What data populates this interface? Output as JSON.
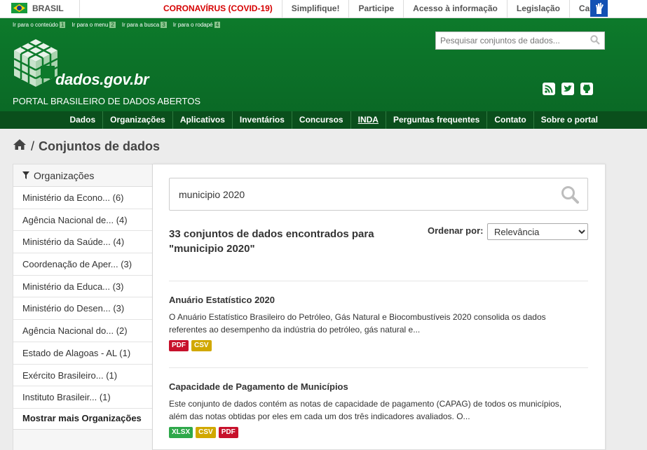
{
  "gov_bar": {
    "country": "BRASIL",
    "links": [
      "CORONAVÍRUS (COVID-19)",
      "Simplifique!",
      "Participe",
      "Acesso à informação",
      "Legislação",
      "Canais"
    ]
  },
  "skip_links": [
    {
      "label": "Ir para o conteúdo",
      "key": "1"
    },
    {
      "label": "Ir para o menu",
      "key": "2"
    },
    {
      "label": "Ir para a busca",
      "key": "3"
    },
    {
      "label": "Ir para o rodapé",
      "key": "4"
    }
  ],
  "header": {
    "logo_text": "dados.gov.br",
    "portal_name": "PORTAL BRASILEIRO DE DADOS ABERTOS",
    "search_placeholder": "Pesquisar conjuntos de dados...",
    "social_icons": [
      "rss-icon",
      "twitter-icon",
      "github-icon"
    ]
  },
  "nav": [
    "Dados",
    "Organizações",
    "Aplicativos",
    "Inventários",
    "Concursos",
    "INDA",
    "Perguntas frequentes",
    "Contato",
    "Sobre o portal"
  ],
  "breadcrumb": {
    "separator": "/",
    "title": "Conjuntos de dados"
  },
  "sidebar": {
    "heading": "Organizações",
    "items": [
      "Ministério da Econo... (6)",
      "Agência Nacional de... (4)",
      "Ministério da Saúde... (4)",
      "Coordenação de Aper... (3)",
      "Ministério da Educa... (3)",
      "Ministério do Desen... (3)",
      "Agência Nacional do... (2)",
      "Estado de Alagoas - AL (1)",
      "Exército Brasileiro... (1)",
      "Instituto Brasileir... (1)"
    ],
    "more": "Mostrar mais Organizações"
  },
  "search": {
    "query": "municipio 2020"
  },
  "results": {
    "count_text": "33 conjuntos de dados encontrados para \"municipio 2020\"",
    "order_label": "Ordenar por:",
    "order_value": "Relevância"
  },
  "datasets": [
    {
      "title": "Anuário Estatístico 2020",
      "description": "O Anuário Estatístico Brasileiro do Petróleo, Gás Natural e Biocombustíveis 2020 consolida os dados referentes ao desempenho da indústria do petróleo, gás natural e...",
      "formats": [
        "PDF",
        "CSV"
      ]
    },
    {
      "title": "Capacidade de Pagamento de Municípios",
      "description": "Este conjunto de dados contém as notas de capacidade de pagamento (CAPAG) de todos os municípios, além das notas obtidas por eles em cada um dos três indicadores avaliados. O...",
      "formats": [
        "XLSX",
        "CSV",
        "PDF"
      ]
    }
  ],
  "colors": {
    "header_green": "#0d7a2b",
    "nav_green": "#0a4f1c",
    "covid_red": "#d60000",
    "pdf": "#c7112b",
    "csv": "#d1a800",
    "xlsx": "#2ea84a"
  }
}
